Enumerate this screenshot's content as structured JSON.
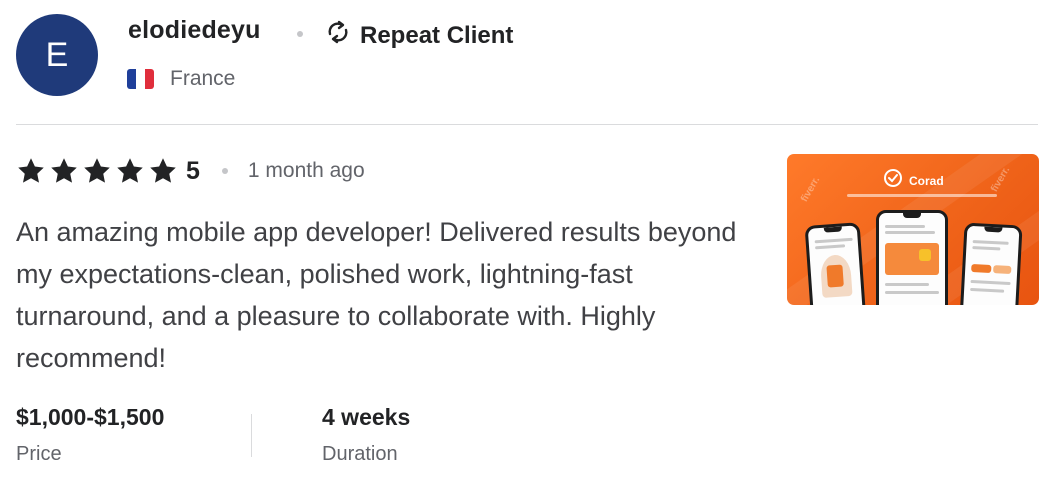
{
  "reviewer": {
    "avatar_initial": "E",
    "username": "elodiedeyu",
    "badge": "Repeat Client",
    "country": "France"
  },
  "review": {
    "rating": "5",
    "time_ago": "1 month ago",
    "text": "An amazing mobile app developer! Delivered results beyond my expectations-clean, polished work, lightning-fast turnaround, and a pleasure to collaborate with. Highly recommend!"
  },
  "meta": {
    "price_value": "$1,000-$1,500",
    "price_label": "Price",
    "duration_value": "4 weeks",
    "duration_label": "Duration"
  },
  "thumbnail": {
    "brand": "Corad",
    "watermark": "fiverr."
  },
  "colors": {
    "avatar_bg": "#1f3a7a",
    "text_dark": "#222325",
    "text_muted": "#62646a",
    "thumb_orange": "#f0641a"
  },
  "icons": {
    "repeat": "repeat-icon",
    "flag": "france-flag-icon",
    "star": "star-icon"
  }
}
